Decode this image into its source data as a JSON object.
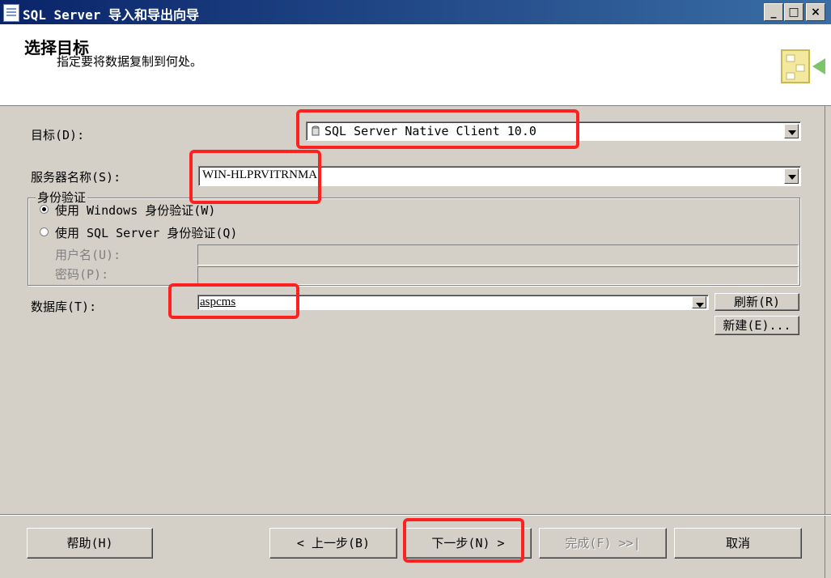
{
  "window": {
    "title": "SQL Server 导入和导出向导"
  },
  "window_controls": {
    "minimize": "_",
    "maximize": "□",
    "close": "×"
  },
  "header": {
    "title": "选择目标",
    "subtitle": "指定要将数据复制到何处。"
  },
  "form": {
    "destination_label": "目标(D):",
    "destination_value": "SQL Server Native Client 10.0",
    "server_label": "服务器名称(S):",
    "server_value": "WIN-HLPRVITRNMA",
    "auth_group_label": "身份验证",
    "auth_windows_label": "使用 Windows 身份验证(W)",
    "auth_sql_label": "使用 SQL Server 身份验证(Q)",
    "auth_selected": "windows",
    "username_label": "用户名(U):",
    "password_label": "密码(P):",
    "database_label": "数据库(T):",
    "database_value": "aspcms",
    "refresh_button": "刷新(R)",
    "new_button": "新建(E)..."
  },
  "footer": {
    "help": "帮助(H)",
    "back": "< 上一步(B)",
    "next": "下一步(N) >",
    "finish": "完成(F) >>|",
    "cancel": "取消"
  },
  "colors": {
    "highlight": "#ff2020",
    "dialog_bg": "#d4d0c8",
    "titlebar": "#0a246a"
  }
}
